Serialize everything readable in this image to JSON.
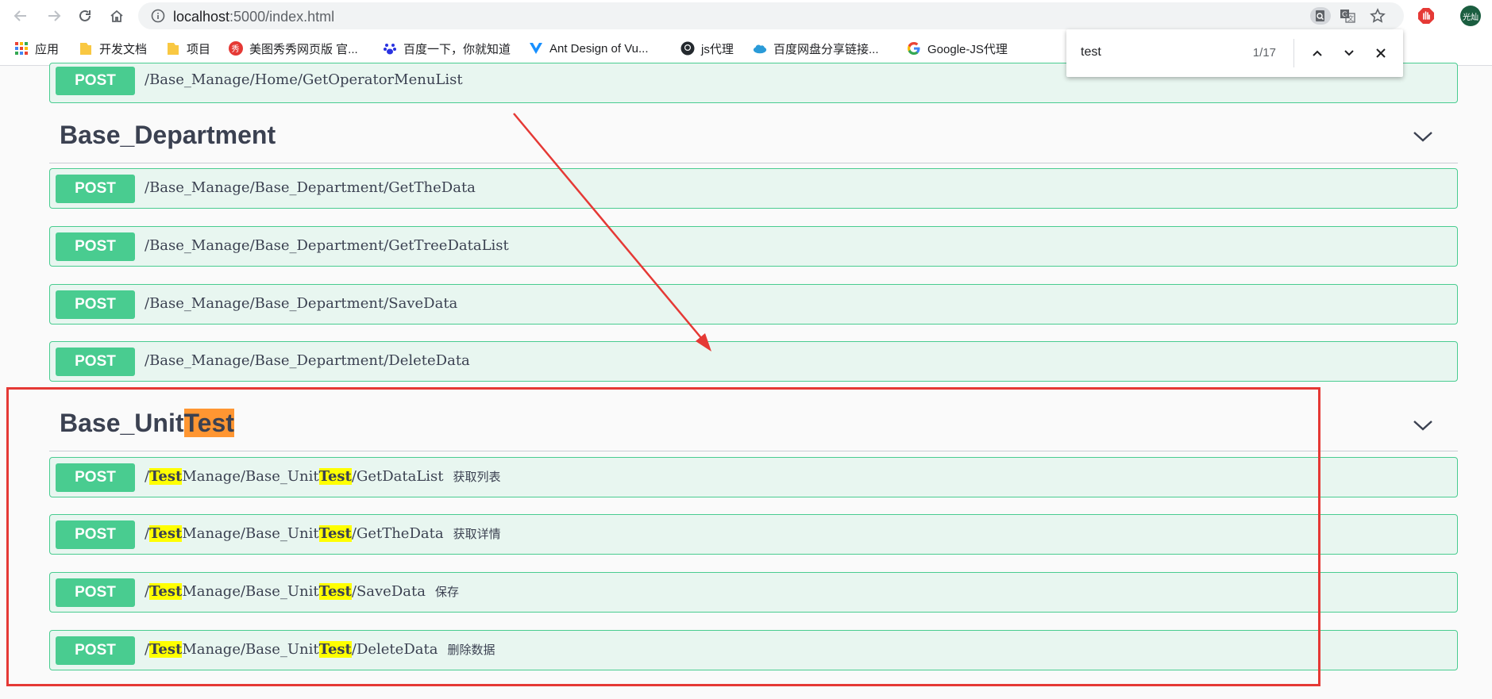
{
  "browser": {
    "url_host": "localhost",
    "url_rest": ":5000/index.html",
    "avatar_text": "光灿",
    "icons": {
      "back": "back-arrow-icon",
      "forward": "forward-arrow-icon",
      "reload": "reload-icon",
      "home": "home-icon",
      "info": "info-icon",
      "find": "find-in-page-icon",
      "translate": "translate-icon",
      "star": "bookmark-star-icon",
      "extension": "adblock-hand-icon"
    }
  },
  "bookmarks": [
    {
      "label": "应用",
      "icon": "apps-grid-icon"
    },
    {
      "label": "开发文档",
      "icon": "folder-icon"
    },
    {
      "label": "项目",
      "icon": "folder-icon"
    },
    {
      "label": "美图秀秀网页版 官...",
      "icon": "meitu-icon"
    },
    {
      "label": "百度一下，你就知道",
      "icon": "baidu-paw-icon"
    },
    {
      "label": "Ant Design of Vu...",
      "icon": "vue-icon"
    },
    {
      "label": "js代理",
      "icon": "github-icon"
    },
    {
      "label": "百度网盘分享链接...",
      "icon": "cloud-icon"
    },
    {
      "label": "Google-JS代理",
      "icon": "google-icon"
    }
  ],
  "find_bar": {
    "query": "test",
    "count": "1/17"
  },
  "colors": {
    "post_green": "#49cc90",
    "op_bg": "#e8f6f0",
    "highlight_yellow": "#ffff00",
    "highlight_orange": "#ff9632",
    "annotation_red": "#e53935"
  },
  "top_op": {
    "method": "POST",
    "path": "/Base_Manage/Home/GetOperatorMenuList"
  },
  "sections": [
    {
      "title": "Base_Department",
      "ops": [
        {
          "method": "POST",
          "path": "/Base_Manage/Base_Department/GetTheData"
        },
        {
          "method": "POST",
          "path": "/Base_Manage/Base_Department/GetTreeDataList"
        },
        {
          "method": "POST",
          "path": "/Base_Manage/Base_Department/SaveData"
        },
        {
          "method": "POST",
          "path": "/Base_Manage/Base_Department/DeleteData"
        }
      ]
    },
    {
      "title_prefix": "Base_Unit",
      "title_match": "Test",
      "ops": [
        {
          "method": "POST",
          "p0": "/",
          "m1": "Test",
          "p1": "Manage/Base_Unit",
          "m2": "Test",
          "p2": "/GetDataList",
          "summary": "获取列表"
        },
        {
          "method": "POST",
          "p0": "/",
          "m1": "Test",
          "p1": "Manage/Base_Unit",
          "m2": "Test",
          "p2": "/GetTheData",
          "summary": "获取详情"
        },
        {
          "method": "POST",
          "p0": "/",
          "m1": "Test",
          "p1": "Manage/Base_Unit",
          "m2": "Test",
          "p2": "/SaveData",
          "summary": "保存"
        },
        {
          "method": "POST",
          "p0": "/",
          "m1": "Test",
          "p1": "Manage/Base_Unit",
          "m2": "Test",
          "p2": "/DeleteData",
          "summary": "删除数据"
        }
      ]
    }
  ]
}
